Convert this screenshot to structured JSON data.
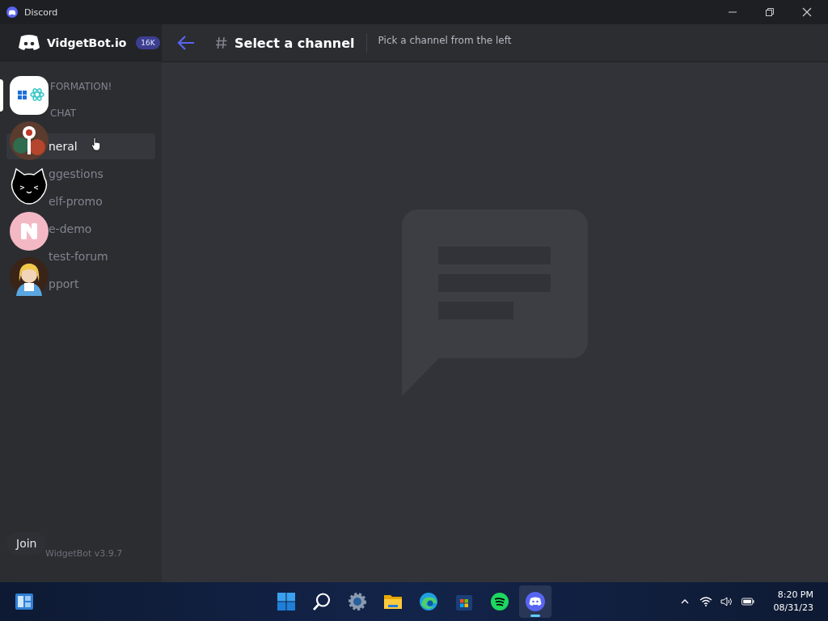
{
  "window": {
    "title": "Discord"
  },
  "server": {
    "name": "VidgetBot.io",
    "badge": "16K"
  },
  "header": {
    "title": "Select a channel",
    "subtitle": "Pick a channel from the left"
  },
  "servers": [
    {
      "kind": "apps",
      "selected": true
    },
    {
      "kind": "key",
      "selected": false
    },
    {
      "kind": "cat",
      "selected": false
    },
    {
      "kind": "letter",
      "selected": false
    },
    {
      "kind": "figure",
      "selected": false
    }
  ],
  "channels": [
    {
      "kind": "category",
      "label": "FORMATION!"
    },
    {
      "kind": "category",
      "label": "CHAT"
    },
    {
      "kind": "text",
      "label": "neral",
      "selected": true
    },
    {
      "kind": "text",
      "label": "ggestions",
      "selected": false
    },
    {
      "kind": "text",
      "label": "elf-promo",
      "selected": false
    },
    {
      "kind": "text",
      "label": "e-demo",
      "selected": false
    },
    {
      "kind": "text",
      "label": "test-forum",
      "selected": false
    },
    {
      "kind": "text",
      "label": "pport",
      "selected": false
    }
  ],
  "join_button": "Join",
  "footer": "WidgetBot v3.9.7",
  "taskbar": {
    "apps": [
      {
        "kind": "start",
        "active": false
      },
      {
        "kind": "search",
        "active": false
      },
      {
        "kind": "settings",
        "active": false
      },
      {
        "kind": "files",
        "active": false
      },
      {
        "kind": "edge",
        "active": false
      },
      {
        "kind": "store",
        "active": false
      },
      {
        "kind": "spotify",
        "active": false
      },
      {
        "kind": "discord",
        "active": true
      }
    ],
    "time": "8:20 PM",
    "date": "08/31/23"
  }
}
